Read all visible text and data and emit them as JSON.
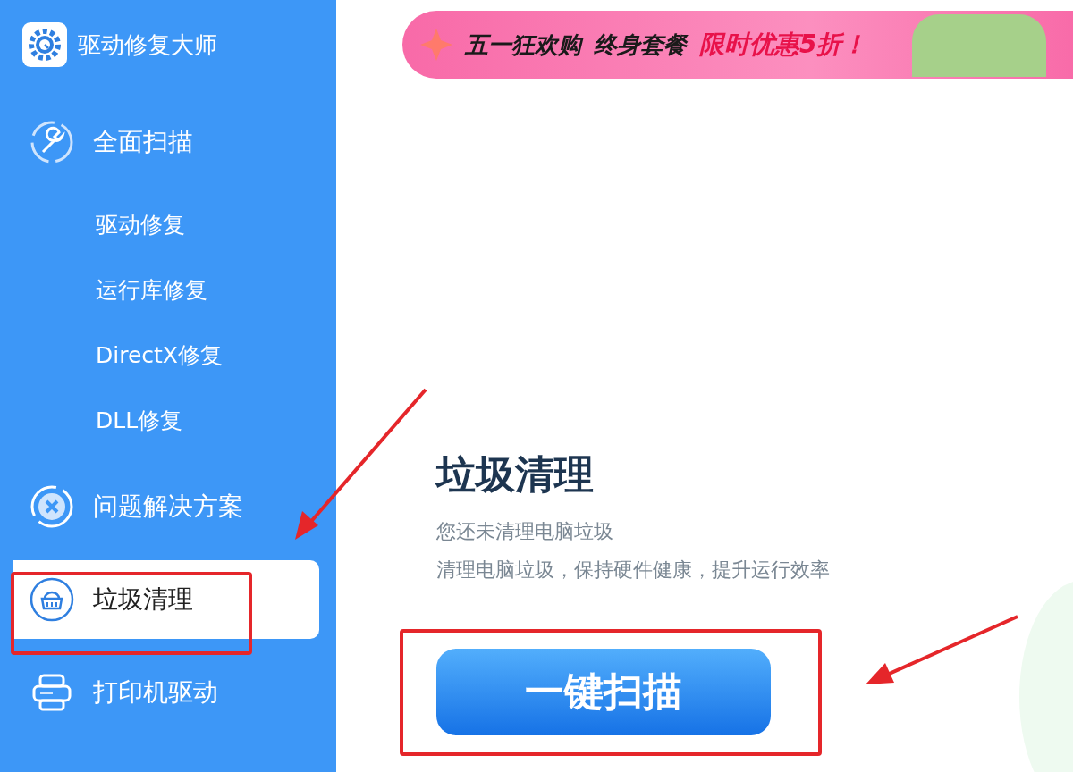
{
  "app": {
    "title": "驱动修复大师"
  },
  "nav": [
    {
      "label": "全面扫描",
      "kind": "main",
      "selected": false
    },
    {
      "label": "驱动修复",
      "kind": "sub",
      "selected": false
    },
    {
      "label": "运行库修复",
      "kind": "sub",
      "selected": false
    },
    {
      "label": "DirectX修复",
      "kind": "sub",
      "selected": false
    },
    {
      "label": "DLL修复",
      "kind": "sub",
      "selected": false
    },
    {
      "label": "问题解决方案",
      "kind": "main",
      "selected": false
    },
    {
      "label": "垃圾清理",
      "kind": "main",
      "selected": true
    },
    {
      "label": "打印机驱动",
      "kind": "main",
      "selected": false
    }
  ],
  "banner": {
    "texts": [
      "五一狂欢购",
      "终身套餐"
    ],
    "highlight": "限时优惠5折！"
  },
  "panel": {
    "title": "垃圾清理",
    "lines": [
      "您还未清理电脑垃圾",
      "清理电脑垃圾，保持硬件健康，提升运行效率"
    ],
    "button": "一键扫描"
  }
}
